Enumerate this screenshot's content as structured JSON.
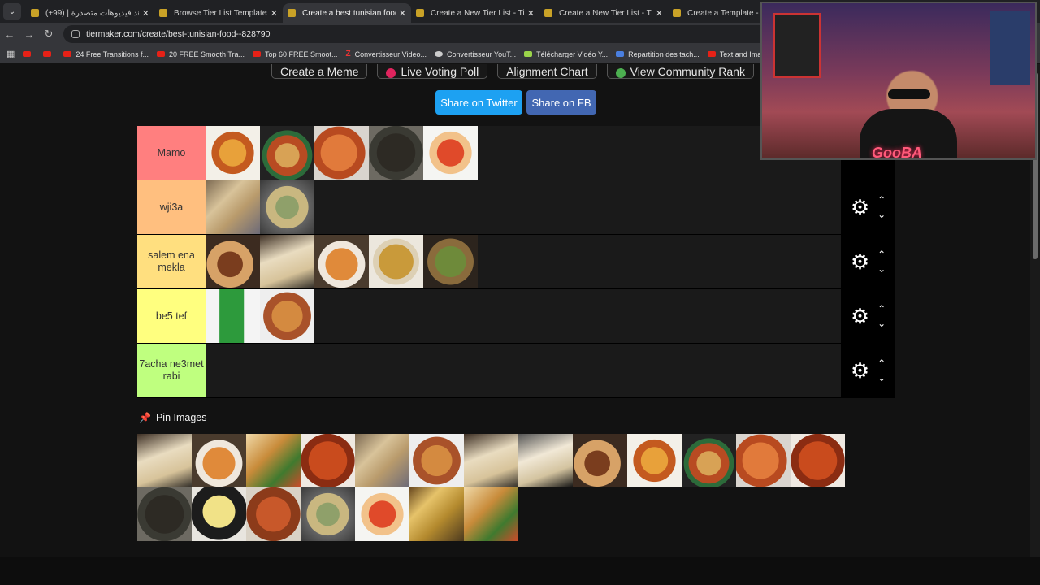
{
  "browser": {
    "tabs": [
      {
        "title": "شاهد فيديوهات متصدرة | (99+)",
        "active": false
      },
      {
        "title": "Browse Tier List Templates by C",
        "active": false
      },
      {
        "title": "Create a best tunisian food Tier",
        "active": true
      },
      {
        "title": "Create a New Tier List - TierMa",
        "active": false
      },
      {
        "title": "Create a New Tier List - TierMa",
        "active": false
      },
      {
        "title": "Create a Template - TierMa",
        "active": false
      }
    ],
    "url": "tiermaker.com/create/best-tunisian-food--828790",
    "bookmarks": [
      "24 Free Transitions f...",
      "20 FREE Smooth Tra...",
      "Top 60 FREE Smoot...",
      "Convertisseur Video...",
      "Convertisseur YouT...",
      "Télécharger Vidéo Y...",
      "Repartition des tach...",
      "Text and Image ani..."
    ]
  },
  "page": {
    "top_buttons": [
      "Create a Meme",
      "Live Voting Poll",
      "Alignment Chart",
      "View Community Rank"
    ],
    "share_twitter": "Share on Twitter",
    "share_fb": "Share on FB",
    "pin_title": "Pin Images"
  },
  "tiers": [
    {
      "label": "Mamo",
      "color": "#ff7f7f",
      "items": [
        "couscous",
        "lablabi",
        "shakshuka",
        "mloukhia",
        "pasta"
      ]
    },
    {
      "label": "wji3a",
      "color": "#ffbf7f",
      "items": [
        "malsouka",
        "soup"
      ]
    },
    {
      "label": "salem ena mekla",
      "color": "#ffdf7f",
      "items": [
        "kafteji",
        "mlawi",
        "chorba",
        "osban",
        "brik"
      ]
    },
    {
      "label": "be5 tef",
      "color": "#ffff7f",
      "items": [
        "boga",
        "madfouna"
      ]
    },
    {
      "label": "7acha ne3met rabi",
      "color": "#bfff7f",
      "items": []
    }
  ],
  "pool_items": [
    "mlawi",
    "chorba",
    "fries",
    "mtabga",
    "malsouka",
    "madfouna",
    "mlawi",
    "mlawi2",
    "kafteji",
    "couscous",
    "lablabi",
    "shakshuka",
    "mtabga",
    "mloukhia",
    "omelet",
    "rice",
    "soup",
    "pasta",
    "tajine",
    "fries"
  ],
  "overlay": {
    "streamer_logo": "GooBA"
  }
}
